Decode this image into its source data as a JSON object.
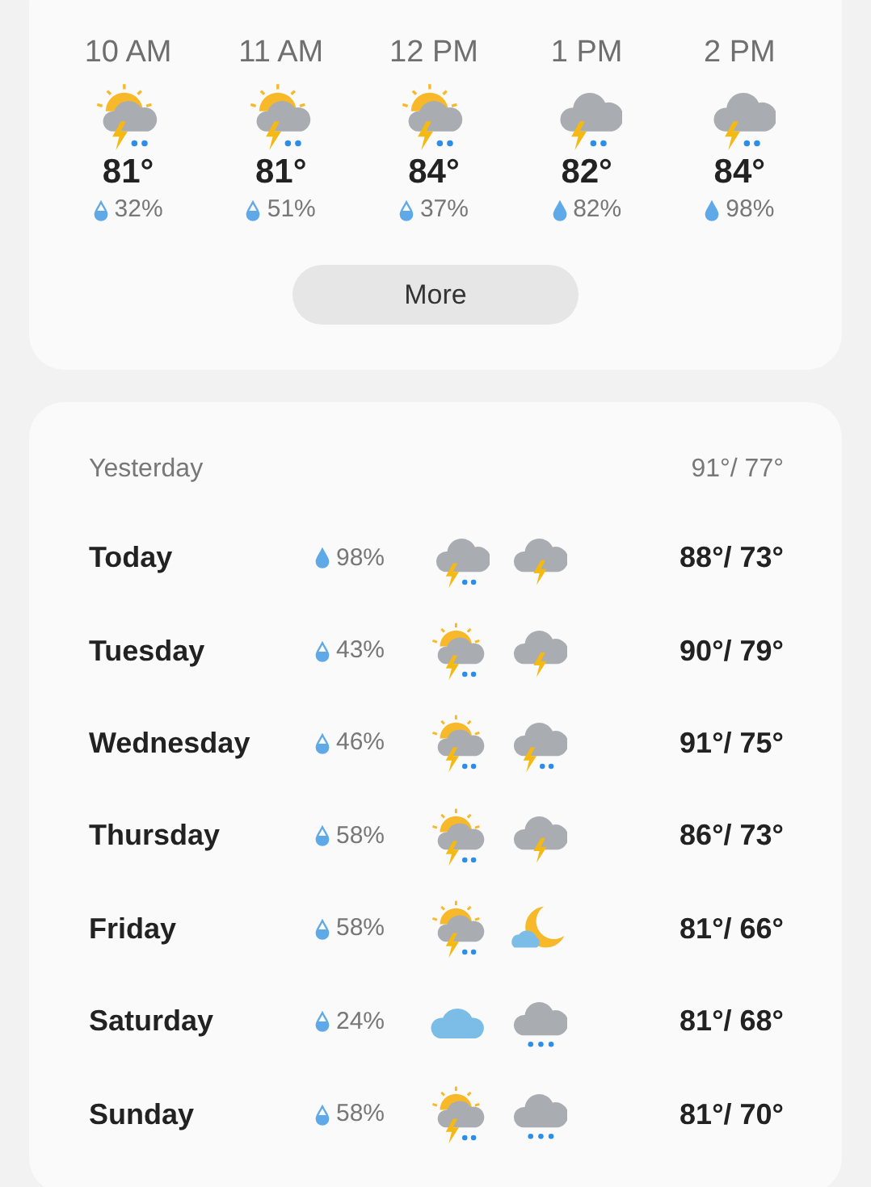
{
  "hourly": [
    {
      "time": "10 AM",
      "icon": {
        "kind": "sunstorm"
      },
      "temp": "81°",
      "precip": "32%",
      "drop_full": false
    },
    {
      "time": "11 AM",
      "icon": {
        "kind": "sunstorm"
      },
      "temp": "81°",
      "precip": "51%",
      "drop_full": false
    },
    {
      "time": "12 PM",
      "icon": {
        "kind": "sunstorm"
      },
      "temp": "84°",
      "precip": "37%",
      "drop_full": false
    },
    {
      "time": "1 PM",
      "icon": {
        "kind": "stormrain"
      },
      "temp": "82°",
      "precip": "82%",
      "drop_full": true
    },
    {
      "time": "2 PM",
      "icon": {
        "kind": "stormrain"
      },
      "temp": "84°",
      "precip": "98%",
      "drop_full": true
    }
  ],
  "more_button": "More",
  "yesterday": {
    "label": "Yesterday",
    "temps": "91°/ 77°"
  },
  "daily": [
    {
      "day": "Today",
      "precip": "98%",
      "drop_full": true,
      "icons": [
        {
          "kind": "stormrain"
        },
        {
          "kind": "storm"
        }
      ],
      "temps": "88°/ 73°"
    },
    {
      "day": "Tuesday",
      "precip": "43%",
      "drop_full": false,
      "icons": [
        {
          "kind": "sunstorm"
        },
        {
          "kind": "storm"
        }
      ],
      "temps": "90°/ 79°"
    },
    {
      "day": "Wednesday",
      "precip": "46%",
      "drop_full": false,
      "icons": [
        {
          "kind": "sunstorm"
        },
        {
          "kind": "stormrain"
        }
      ],
      "temps": "91°/ 75°"
    },
    {
      "day": "Thursday",
      "precip": "58%",
      "drop_full": false,
      "icons": [
        {
          "kind": "sunstorm"
        },
        {
          "kind": "storm"
        }
      ],
      "temps": "86°/ 73°"
    },
    {
      "day": "Friday",
      "precip": "58%",
      "drop_full": false,
      "icons": [
        {
          "kind": "sunstorm"
        },
        {
          "kind": "moon"
        }
      ],
      "temps": "81°/ 66°"
    },
    {
      "day": "Saturday",
      "precip": "24%",
      "drop_full": false,
      "icons": [
        {
          "kind": "cloud"
        },
        {
          "kind": "rain"
        }
      ],
      "temps": "81°/ 68°"
    },
    {
      "day": "Sunday",
      "precip": "58%",
      "drop_full": false,
      "icons": [
        {
          "kind": "sunstorm"
        },
        {
          "kind": "rain"
        }
      ],
      "temps": "81°/ 70°"
    }
  ]
}
